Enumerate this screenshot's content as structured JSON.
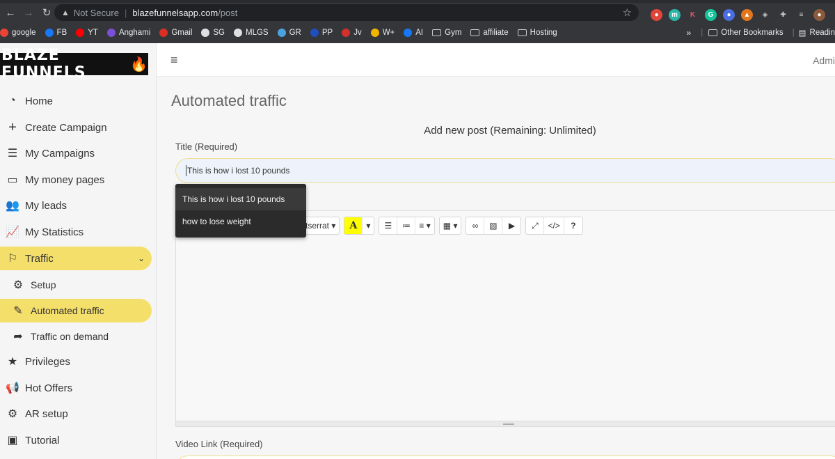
{
  "browser": {
    "security_label": "Not Secure",
    "url_host": "blazefunnelsapp.com",
    "url_path": "/post",
    "bookmarks": [
      {
        "label": "google",
        "color": "#ea4335",
        "icon": "google-icon"
      },
      {
        "label": "FB",
        "color": "#1877f2",
        "icon": "facebook-icon"
      },
      {
        "label": "YT",
        "color": "#ff0000",
        "icon": "youtube-icon"
      },
      {
        "label": "Anghami",
        "color": "#7b4fd6",
        "icon": "anghami-icon"
      },
      {
        "label": "Gmail",
        "color": "#d93025",
        "icon": "gmail-icon"
      },
      {
        "label": "SG",
        "color": "#e0e0e0",
        "icon": "sg-icon"
      },
      {
        "label": "MLGS",
        "color": "#e0e0e0",
        "icon": "globe-icon"
      },
      {
        "label": "GR",
        "color": "#4aa3df",
        "icon": "mail-icon"
      },
      {
        "label": "PP",
        "color": "#1f4fbf",
        "icon": "paypal-icon"
      },
      {
        "label": "Jv",
        "color": "#d0312d",
        "icon": "jv-icon"
      },
      {
        "label": "W+",
        "color": "#f0b400",
        "icon": "warrior-icon"
      },
      {
        "label": "AI",
        "color": "#1877f2",
        "icon": "facebook-icon"
      },
      {
        "label": "Gym",
        "color": "",
        "icon": "folder-icon"
      },
      {
        "label": "affiliate",
        "color": "",
        "icon": "folder-icon"
      },
      {
        "label": "Hosting",
        "color": "",
        "icon": "folder-icon"
      }
    ],
    "overflow": "»",
    "other_bookmarks": "Other Bookmarks",
    "reading_list": "Readin"
  },
  "sidebar": {
    "logo_text": "BLAZE FUNNELS",
    "items": [
      {
        "label": "Home",
        "icon": "dashboard-icon"
      },
      {
        "label": "Create Campaign",
        "icon": "plus-icon"
      },
      {
        "label": "My Campaigns",
        "icon": "list-icon"
      },
      {
        "label": "My money pages",
        "icon": "folder-icon"
      },
      {
        "label": "My leads",
        "icon": "users-icon"
      },
      {
        "label": "My Statistics",
        "icon": "chart-line-icon"
      },
      {
        "label": "Traffic",
        "icon": "signpost-icon"
      },
      {
        "label": "Setup",
        "icon": "gear-icon"
      },
      {
        "label": "Automated traffic",
        "icon": "edit-icon"
      },
      {
        "label": "Traffic on demand",
        "icon": "share-icon"
      },
      {
        "label": "Privileges",
        "icon": "star-icon"
      },
      {
        "label": "Hot Offers",
        "icon": "megaphone-icon"
      },
      {
        "label": "AR setup",
        "icon": "gears-icon"
      },
      {
        "label": "Tutorial",
        "icon": "tv-icon"
      }
    ]
  },
  "topbar": {
    "admin_label": "Admi"
  },
  "main": {
    "page_title": "Automated traffic",
    "form_heading": "Add new post (Remaining: Unlimited)",
    "title_label": "Title (Required)",
    "title_value": "This is how i lost 10 pounds",
    "video_label": "Video Link (Required)",
    "toolbar": {
      "font_name": "tserrat",
      "color_button": "A"
    },
    "autocomplete": [
      "This is how i lost 10 pounds",
      "how to lose weight"
    ]
  },
  "colors": {
    "accent": "#f5df6b",
    "browser_dark": "#35363a",
    "sidebar_bg": "#f5f5f5"
  }
}
